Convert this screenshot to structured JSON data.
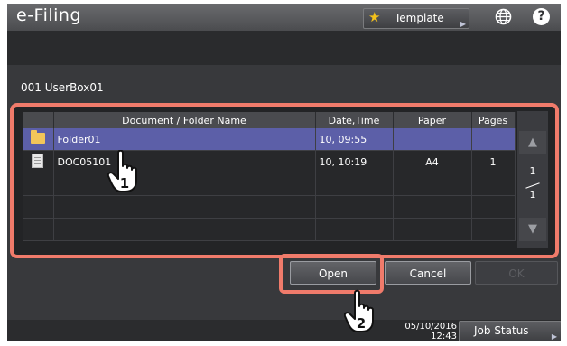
{
  "titlebar": {
    "app_title": "e-Filing",
    "template_label": "Template",
    "icons": [
      "star-icon",
      "globe-icon",
      "help-icon"
    ],
    "help_glyph": "?"
  },
  "box_label": "001 UserBox01",
  "table": {
    "headers": [
      "Document / Folder Name",
      "Date,Time",
      "Paper",
      "Pages"
    ],
    "rows": [
      {
        "icon": "folder-icon",
        "name": "Folder01",
        "datetime": "10, 09:55",
        "paper": "",
        "pages": "",
        "selected": true
      },
      {
        "icon": "document-icon",
        "name": "DOC05101",
        "datetime": "10, 10:19",
        "paper": "A4",
        "pages": "1",
        "selected": false
      }
    ]
  },
  "pager": {
    "current": "1",
    "total": "1"
  },
  "buttons": {
    "open": "Open",
    "cancel": "Cancel",
    "ok": "OK"
  },
  "status": {
    "date": "05/10/2016",
    "time": "12:43",
    "job_status": "Job Status"
  },
  "callouts": [
    "1",
    "2"
  ],
  "colors": {
    "highlight": "#f07b6b",
    "selected_row": "#5c5fa8",
    "folder": "#f3c65a"
  }
}
